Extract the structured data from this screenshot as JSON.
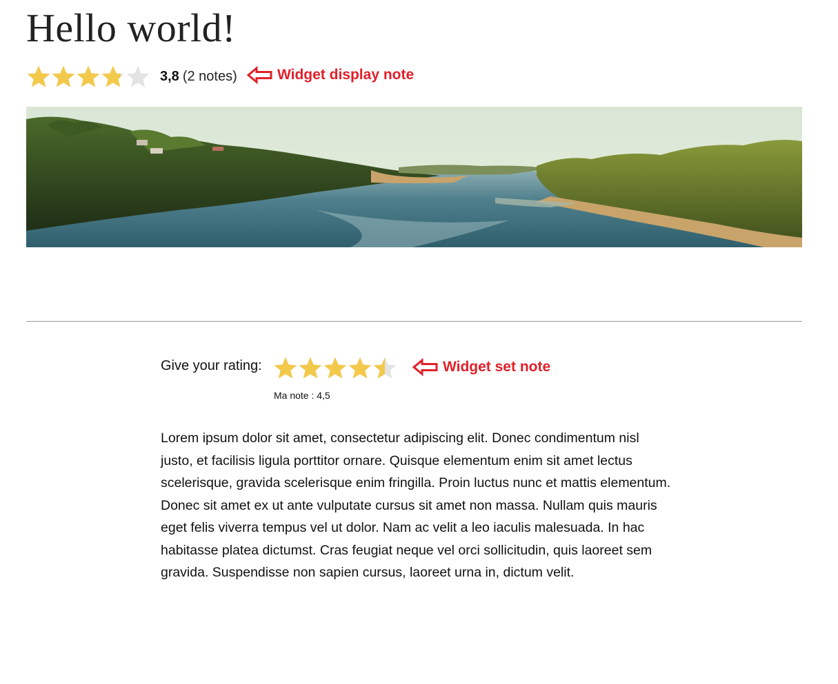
{
  "page": {
    "title": "Hello world!"
  },
  "rating_display": {
    "value_text": "3,8",
    "count_text": "(2 notes)",
    "rating": 3.8,
    "max": 5,
    "star_color": "#f3c94c",
    "empty_color": "#e3e3e3"
  },
  "annotations": {
    "display": "Widget display note",
    "set": "Widget set note",
    "color": "#e0202a"
  },
  "rating_input": {
    "label": "Give your rating:",
    "rating": 4.5,
    "max": 5,
    "note_text": "Ma note : 4,5"
  },
  "article": {
    "body": "Lorem ipsum dolor sit amet, consectetur adipiscing elit. Donec condimentum nisl justo, et facilisis ligula porttitor ornare. Quisque elementum enim sit amet lectus scelerisque, gravida scelerisque enim fringilla. Proin luctus nunc et mattis elementum. Donec sit amet ex ut ante vulputate cursus sit amet non massa. Nullam quis mauris eget felis viverra tempus vel ut dolor. Nam ac velit a leo iaculis malesuada. In hac habitasse platea dictumst. Cras feugiat neque vel orci sollicitudin, quis laoreet sem gravida. Suspendisse non sapien cursus, laoreet urna in, dictum velit."
  }
}
